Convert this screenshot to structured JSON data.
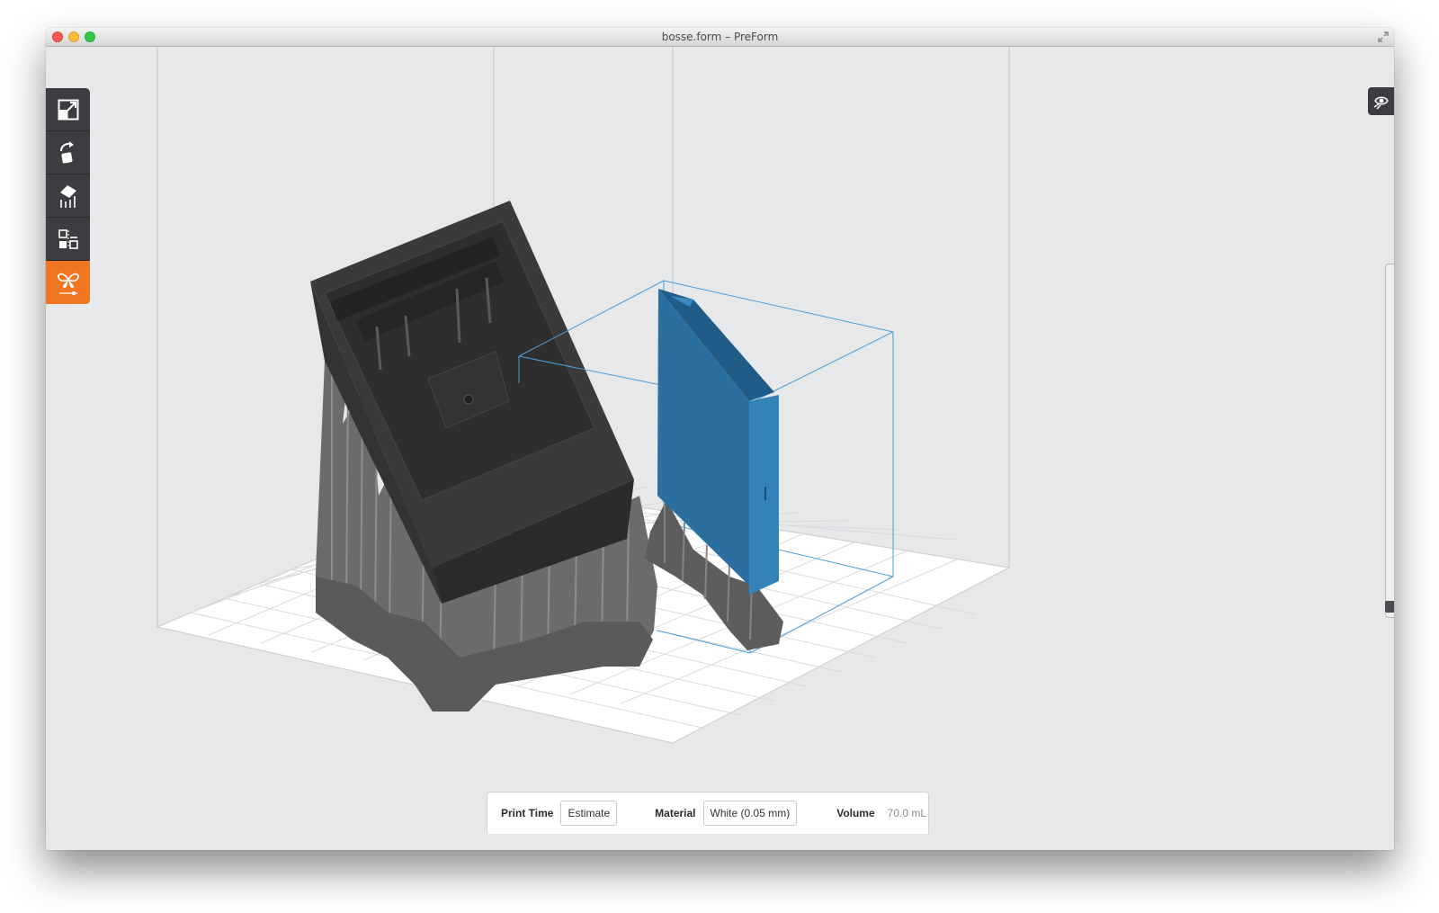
{
  "window": {
    "title": "bosse.form – PreForm"
  },
  "toolbar": {
    "tools": [
      {
        "name": "scale-tool",
        "icon": "scale-icon"
      },
      {
        "name": "orientation-tool",
        "icon": "rotate-icon"
      },
      {
        "name": "supports-tool",
        "icon": "supports-icon"
      },
      {
        "name": "layout-tool",
        "icon": "layout-icon"
      },
      {
        "name": "print-tool",
        "icon": "butterfly-print-icon",
        "active": true
      }
    ]
  },
  "view_toggle": {
    "icon": "eye-view-icon"
  },
  "status": {
    "print_time_label": "Print Time",
    "estimate_button": "Estimate",
    "material_label": "Material",
    "material_value": "White (0.05 mm)",
    "volume_label": "Volume",
    "volume_value": "70.0 mL"
  },
  "colors": {
    "accent": "#f07622",
    "selected_model": "#2a79ad",
    "model": "#3c3c3c",
    "supports": "#6a6a6a",
    "toolbar": "#3b3d40"
  }
}
